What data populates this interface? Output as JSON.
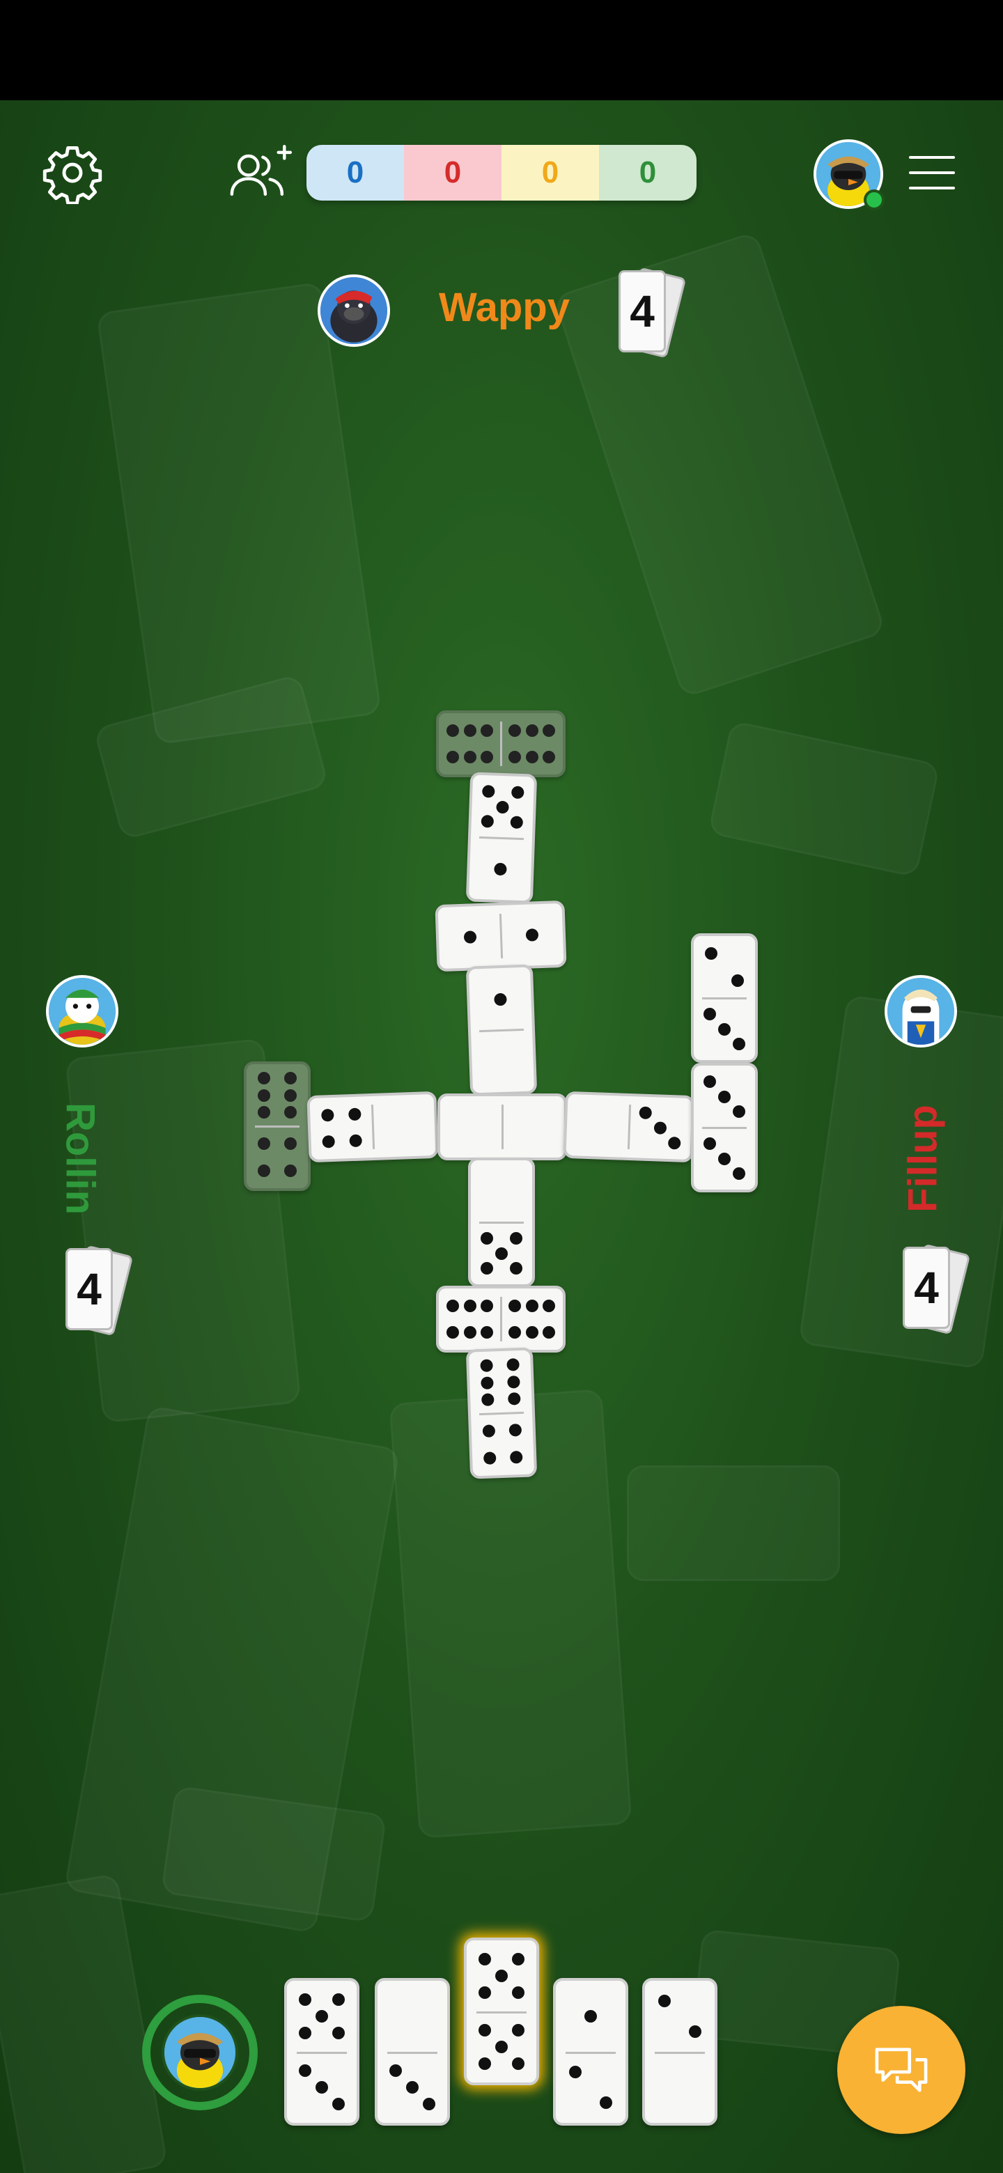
{
  "scores": [
    {
      "value": "0",
      "bg": "#cfe6f6",
      "color": "#1a6fc4"
    },
    {
      "value": "0",
      "bg": "#f9c9cf",
      "color": "#d52b2b"
    },
    {
      "value": "0",
      "bg": "#fbf4c2",
      "color": "#f0a81a"
    },
    {
      "value": "0",
      "bg": "#cfe8cf",
      "color": "#2f8f3a"
    }
  ],
  "players": {
    "top": {
      "name": "Wappy",
      "color": "#f0891a",
      "tiles_left": "4"
    },
    "left": {
      "name": "Rollin",
      "color": "#2f9a3c",
      "tiles_left": "4"
    },
    "right": {
      "name": "Fillup",
      "color": "#d42a2a",
      "tiles_left": "4"
    }
  },
  "icons": {
    "settings": "gear-icon",
    "friends": "add-friends-icon",
    "menu": "hamburger-menu-icon",
    "chat": "chat-bubbles-icon"
  },
  "colors": {
    "chat_button": "#f9b233",
    "turn_ring": "#2e9e3e",
    "online_dot": "#27c04a"
  }
}
